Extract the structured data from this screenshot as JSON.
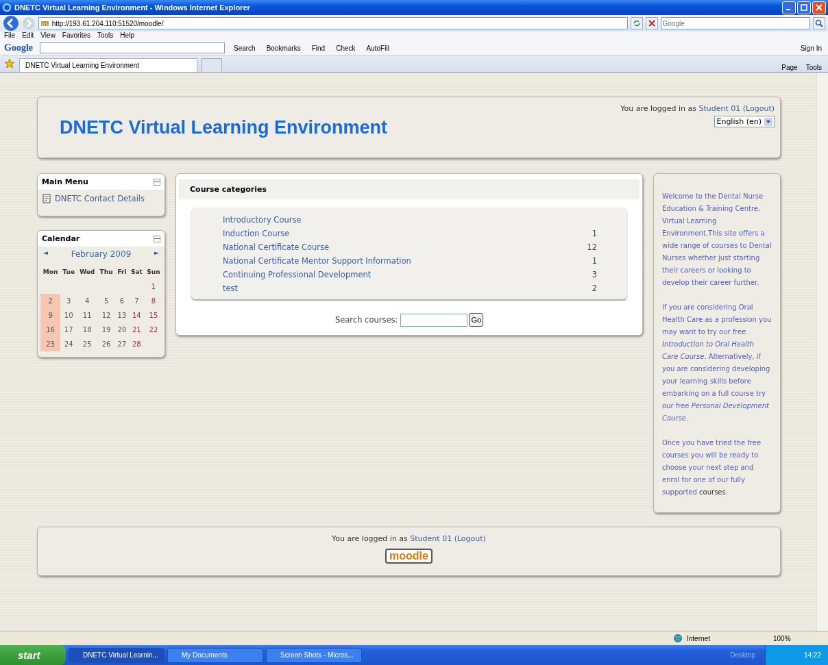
{
  "window": {
    "title": "DNETC Virtual Learning Environment - Windows Internet Explorer"
  },
  "address_bar": {
    "url": "http://193.61.204.110:51520/moodle/",
    "search_placeholder": "Google"
  },
  "menu": [
    "File",
    "Edit",
    "View",
    "Favorites",
    "Tools",
    "Help"
  ],
  "google_toolbar": {
    "logo": "Google",
    "search_label": "Search",
    "buttons": [
      "Bookmarks",
      "Find",
      "Check",
      "AutoFill"
    ],
    "sign_in": "Sign In"
  },
  "tabs": [
    {
      "label": "DNETC Virtual Learning Environment",
      "selected": true
    }
  ],
  "command_bar": [
    "Page",
    "Tools"
  ],
  "header": {
    "site_title": "DNETC Virtual Learning Environment",
    "login_prefix": "You are logged in as",
    "user": "Student 01",
    "logout": "(Logout)",
    "language": "English (en)"
  },
  "main_menu": {
    "title": "Main Menu",
    "items": [
      "DNETC Contact Details"
    ]
  },
  "calendar": {
    "title": "Calendar",
    "prev": "◄",
    "month": "February 2009",
    "next": "►",
    "weekdays": [
      "Mon",
      "Tue",
      "Wed",
      "Thu",
      "Fri",
      "Sat",
      "Sun"
    ],
    "weeks": [
      [
        {
          "day": "1",
          "weekend": true,
          "event": false
        }
      ],
      [
        {
          "day": "2",
          "weekend": false,
          "event": true
        },
        {
          "day": "3",
          "weekend": false,
          "event": false
        },
        {
          "day": "4",
          "weekend": false,
          "event": false
        },
        {
          "day": "5",
          "weekend": false,
          "event": false
        },
        {
          "day": "6",
          "weekend": false,
          "event": false
        },
        {
          "day": "7",
          "weekend": true,
          "event": false
        },
        {
          "day": "8",
          "weekend": true,
          "event": false
        }
      ],
      [
        {
          "day": "9",
          "weekend": false,
          "event": true
        },
        {
          "day": "10",
          "weekend": false,
          "event": false
        },
        {
          "day": "11",
          "weekend": false,
          "event": false
        },
        {
          "day": "12",
          "weekend": false,
          "event": false
        },
        {
          "day": "13",
          "weekend": false,
          "event": false
        },
        {
          "day": "14",
          "weekend": true,
          "event": false
        },
        {
          "day": "15",
          "weekend": true,
          "event": false
        }
      ],
      [
        {
          "day": "16",
          "weekend": false,
          "event": true
        },
        {
          "day": "17",
          "weekend": false,
          "event": false
        },
        {
          "day": "18",
          "weekend": false,
          "event": false
        },
        {
          "day": "19",
          "weekend": false,
          "event": false
        },
        {
          "day": "20",
          "weekend": false,
          "event": false
        },
        {
          "day": "21",
          "weekend": true,
          "event": false
        },
        {
          "day": "22",
          "weekend": true,
          "event": false
        }
      ],
      [
        {
          "day": "23",
          "weekend": false,
          "event": true
        },
        {
          "day": "24",
          "weekend": false,
          "event": false
        },
        {
          "day": "25",
          "weekend": false,
          "event": false
        },
        {
          "day": "26",
          "weekend": false,
          "event": false
        },
        {
          "day": "27",
          "weekend": false,
          "event": false
        },
        {
          "day": "28",
          "weekend": true,
          "event": false
        }
      ]
    ]
  },
  "course_categories": {
    "title": "Course categories",
    "rows": [
      {
        "name": "Introductory Course"
      },
      {
        "name": "Induction Course",
        "count": "1"
      },
      {
        "name": "National Certificate Course",
        "count": "12"
      },
      {
        "name": "National Certificate Mentor Support Information",
        "count": "1"
      },
      {
        "name": "Continuing Professional Development",
        "count": "3"
      },
      {
        "name": "test",
        "count": "2"
      }
    ],
    "search_label": "Search courses:",
    "go": "Go"
  },
  "welcome": [
    [
      {
        "kind": "plain",
        "text": "Welcome to the Dental Nurse Education & Training Centre, Virtual Learning Environment.This site offers a wide range of courses to Dental Nurses whether just starting their careers or looking to develop their career further."
      }
    ],
    [
      {
        "kind": "plain",
        "text": "If you are considering Oral Health Care as a profession you may want to try our free "
      },
      {
        "kind": "italic",
        "text": "Introduction to Oral Health Care Course"
      },
      {
        "kind": "plain",
        "text": ". Alternatively, if you are considering developing your learning skills before embarking on a full course try our free "
      },
      {
        "kind": "italic",
        "text": "Personal Development Course"
      },
      {
        "kind": "plain",
        "text": "."
      }
    ],
    [
      {
        "kind": "plain",
        "text": "Once you have tried the free courses you will be ready to choose your next step and enrol for one of our fully supported "
      },
      {
        "kind": "link",
        "text": "courses"
      },
      {
        "kind": "plain",
        "text": "."
      }
    ]
  ],
  "footer": {
    "login_prefix": "You are logged in as",
    "user": "Student 01",
    "logout": "(Logout)",
    "logo": "moodle"
  },
  "status_bar": {
    "zone": "Internet",
    "zoom": "100%"
  },
  "taskbar": {
    "start": "start",
    "buttons": [
      {
        "label": "DNETC Virtual Learnin...",
        "selected": true
      },
      {
        "label": "My Documents",
        "selected": false
      },
      {
        "label": "Screen Shots - Micros...",
        "selected": false
      }
    ],
    "desktop": "Desktop",
    "time": "14:22"
  }
}
